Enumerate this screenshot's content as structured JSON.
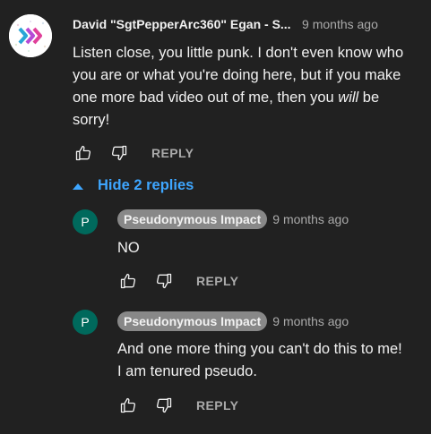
{
  "main_comment": {
    "author": "David \"SgtPepperArc360\" Egan - S...",
    "time": "9 months ago",
    "text_part1": "Listen close, you little punk. I don't even know who you are or what you're doing here, but if you make one more bad video out of me, then you ",
    "text_emphasis": "will",
    "text_part2": " be sorry!",
    "reply_label": "REPLY"
  },
  "replies_toggle": {
    "label": "Hide 2 replies",
    "color": "#3ea6ff"
  },
  "replies": [
    {
      "avatar_letter": "P",
      "author": "Pseudonymous Impact",
      "time": "9 months ago",
      "text": "NO",
      "reply_label": "REPLY"
    },
    {
      "avatar_letter": "P",
      "author": "Pseudonymous Impact",
      "time": "9 months ago",
      "text": "And one more thing you can't do this to me! I am tenured pseudo.",
      "reply_label": "REPLY"
    }
  ],
  "colors": {
    "background": "#212121",
    "text_primary": "#f1f1f1",
    "text_secondary": "#aaaaaa",
    "link_blue": "#3ea6ff",
    "reply_avatar": "#00695c",
    "author_badge": "#888888"
  },
  "icons": {
    "like": "thumbs-up-icon",
    "dislike": "thumbs-down-icon",
    "collapse": "caret-up-icon"
  }
}
